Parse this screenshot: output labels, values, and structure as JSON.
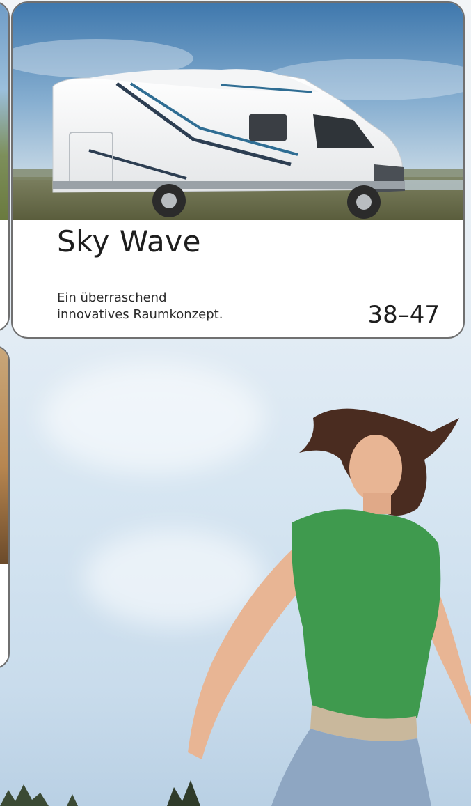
{
  "card": {
    "title": "Sky Wave",
    "description_line1": "Ein überraschend",
    "description_line2": "innovatives Raumkonzept.",
    "pages": "38–47"
  },
  "colors": {
    "card_border": "#707070",
    "sky": "#5f8fbd",
    "shirt": "#3f9a4e"
  }
}
